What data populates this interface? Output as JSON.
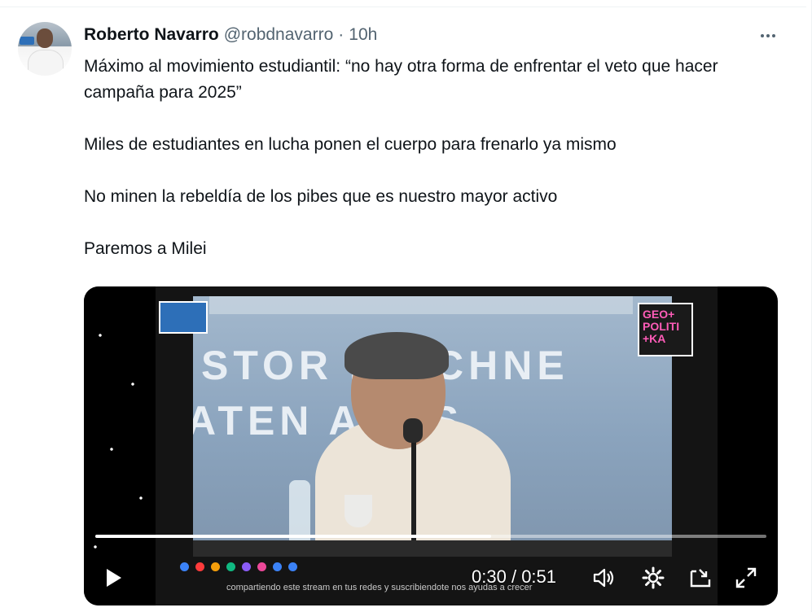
{
  "post": {
    "author_name": "Roberto Navarro",
    "author_handle": "@robdnavarro",
    "separator": "·",
    "time": "10h",
    "paragraphs": [
      "Máximo al movimiento estudiantil: “no hay otra forma de enfrentar el veto que hacer campaña para 2025”",
      "Miles de estudiantes en lucha ponen el cuerpo para frenarlo ya mismo",
      "No minen la rebeldía de los pibes que es nuestro mayor activo",
      "Paremos a Milei"
    ]
  },
  "video": {
    "banner_line1": "STOR KIRCHNE",
    "banner_line2": "ATEN  ANÚS",
    "channel_badge": "GEO+\nPOLITI\n+KA",
    "overlay_text": "compartiendo este stream en tus redes y suscribiendote nos ayudas a crecer",
    "current_time": "0:30",
    "duration": "0:51",
    "progress_fraction": 0.59
  },
  "icons": {
    "more": "more-horizontal-icon",
    "play": "play-icon",
    "volume": "volume-icon",
    "settings": "gear-icon",
    "pip": "picture-in-picture-icon",
    "fullscreen": "fullscreen-icon"
  },
  "colors": {
    "text_primary": "#0f1419",
    "text_secondary": "#536471",
    "video_bg": "#000000"
  }
}
